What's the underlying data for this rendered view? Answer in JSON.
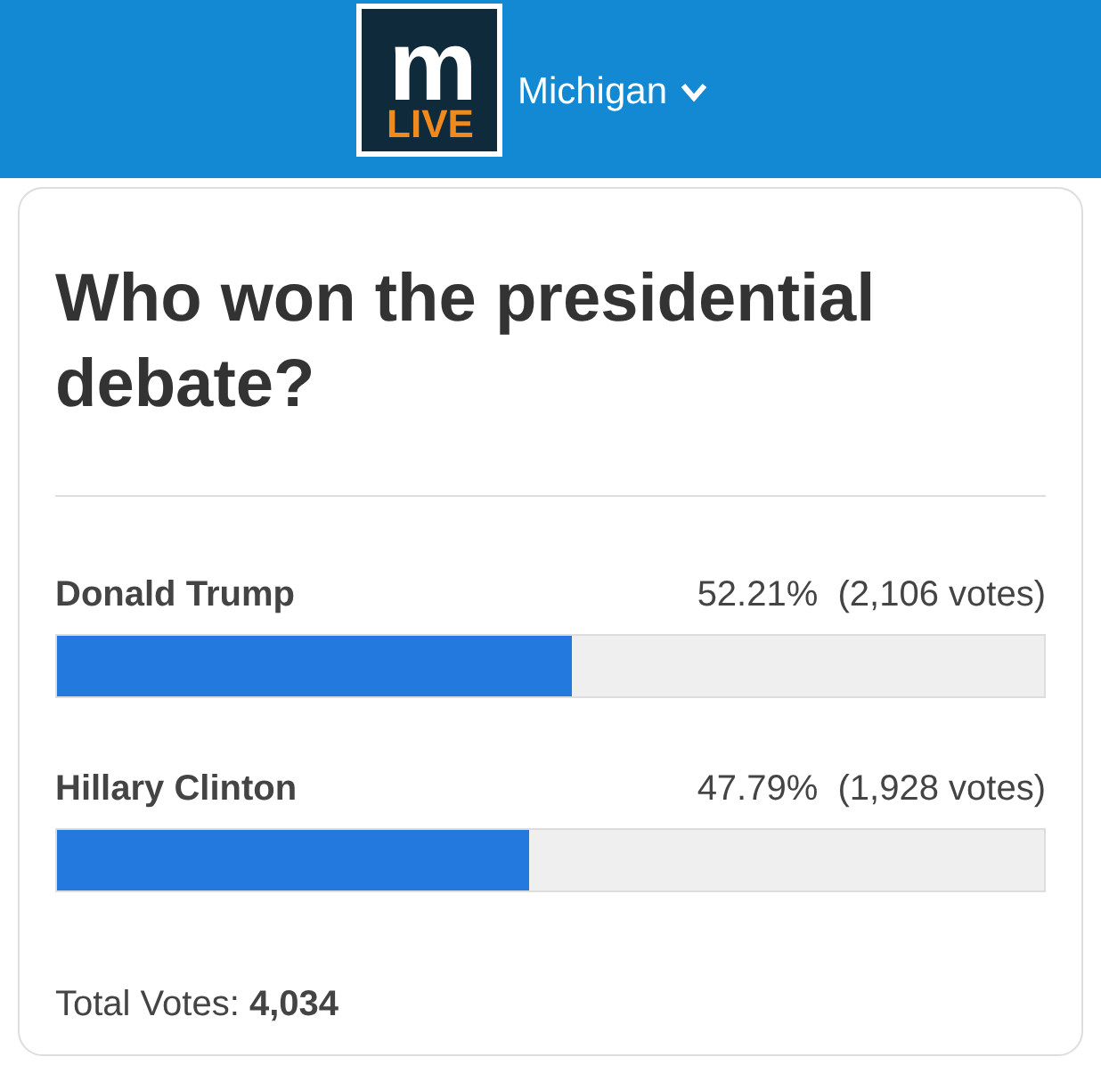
{
  "header": {
    "logo": {
      "top": "m",
      "bottom": "LIVE"
    },
    "region": "Michigan"
  },
  "poll": {
    "question": "Who won the presidential debate?",
    "options": [
      {
        "name": "Donald Trump",
        "result": "52.21%  (2,106 votes)",
        "level": 0.5221
      },
      {
        "name": "Hillary Clinton",
        "result": "47.79%  (1,928 votes)",
        "level": 0.4779
      }
    ],
    "total": "Total Votes: **4,034**"
  }
}
